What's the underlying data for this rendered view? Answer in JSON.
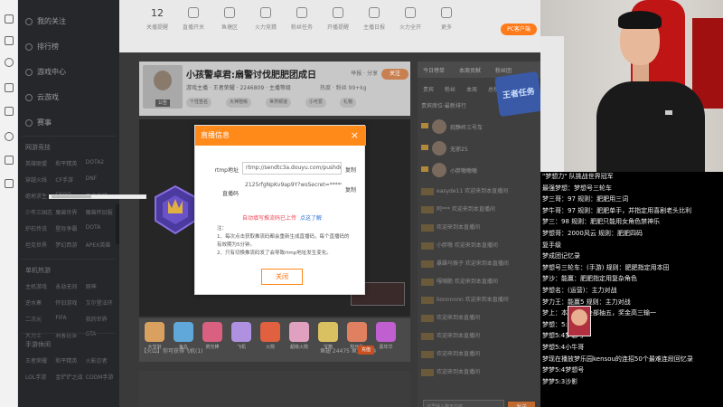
{
  "sidebar": {
    "items": [
      {
        "label": "我的关注"
      },
      {
        "label": "排行榜"
      },
      {
        "label": "游戏中心"
      },
      {
        "label": "云游戏"
      },
      {
        "label": "赛事"
      }
    ],
    "section_games": "网游竞技",
    "games": [
      "英雄联盟",
      "和平精英",
      "DOTA2",
      "穿越火线",
      "CF手游",
      "DNF",
      "绝地求生",
      "CSGO",
      "王者荣耀",
      "少年三国志",
      "魔兽世界",
      "魔兽怀旧服",
      "炉石传说",
      "星际争霸",
      "DOTA",
      "坦克世界",
      "梦幻西游",
      "APEX英雄"
    ],
    "section_mobile": "单机热游",
    "mobile": [
      "主机游戏",
      "永劫无间",
      "原神",
      "逆水寒",
      "怀旧游戏",
      "艾尔登法环",
      "二次元",
      "FIFA",
      "我的世界",
      "大力士",
      "刺客信条",
      "GTA"
    ],
    "section_hand": "手游休闲",
    "hand": [
      "王者荣耀",
      "和平精英",
      "火影忍者",
      "LOL手游",
      "金铲铲之战",
      "CODM手游"
    ]
  },
  "topbar": {
    "stat_value": "12",
    "stat_label": "关播提醒",
    "icons": [
      {
        "label": "直播开关"
      },
      {
        "label": "鱼塘区"
      },
      {
        "label": "火力竞猜"
      },
      {
        "label": "粉丝任务"
      },
      {
        "label": "开播提醒"
      },
      {
        "label": "主播日报"
      },
      {
        "label": "火力全开"
      },
      {
        "label": "更多"
      }
    ],
    "pc_button": "PC客户端"
  },
  "room": {
    "title": "小孩警卓君:扇警讨伐肥肥团成日",
    "subtitle": "游戏主播 · 王者荣耀 · 2246809 · 主播等级",
    "meta": "举报 · 分享",
    "stats": "热度 · 粉丝 99+kg",
    "follow": "关注",
    "avatar_tag": "公告",
    "chips": [
      "个性签名",
      "大神陪练",
      "世界频道",
      "小可爱",
      "礼物"
    ]
  },
  "rpanel": {
    "tabs": [
      "今日榜单",
      "本周贡献",
      "粉丝团"
    ],
    "subtabs": [
      "贵宾",
      "粉丝",
      "本周",
      "总榜"
    ],
    "sub": "贵宾席位·最新排行",
    "promo": "王者任务",
    "rank": [
      {
        "name": "寂静岭三号车"
      },
      {
        "name": "无邪25"
      },
      {
        "name": "小胖嗷嗷嗷"
      }
    ],
    "chat": [
      "easyde11 欢迎来到本直播间",
      "阿*** 欢迎来到本直播间",
      "欢迎来到本直播间",
      "小胖嗷 欢迎来到本直播间",
      "暴躁马猴子 欢迎来到本直播间",
      "嘎嘣脆 欢迎来到本直播间",
      "lionnnnnn 欢迎来到本直播间",
      "欢迎来到本直播间",
      "欢迎来到本直播间",
      "欢迎来到本直播间",
      "欢迎来到本直播间"
    ],
    "input_placeholder": "这里输入聊天内容",
    "send": "发送"
  },
  "gifts": {
    "labels": [
      "大宝剑",
      "鱼丸",
      "荧光棒",
      "飞机",
      "火箭",
      "超级火箭",
      "宝箱",
      "粉丝礼",
      "嘉年华"
    ],
    "status": "【火山】你可获得飞机(1)",
    "balance": "鱼翅 24475  鱼丸 26.4",
    "charge": "充值"
  },
  "modal": {
    "title": "直播信息",
    "close": "×",
    "rtmp_label": "rtmp地址",
    "rtmp_value": "rtmp://sendtc3a.douyu.com/pushdouyu",
    "code_label": "直播码",
    "code_value": "2125rfgNpKv9ap9Y?wsSecret=********",
    "copy": "复制",
    "warn": "自动填写推流码已上传",
    "link": "点这了解",
    "notes": [
      "注：",
      "1、每次点击获取推流码都会重新生成直播码，每个直播码的有效期为5分钟。",
      "2、只有切换推流码发了会导致rtmp地址发生变化。"
    ],
    "confirm": "关闭"
  },
  "overlay": {
    "lines": [
      "\"梦想力\" 队挑战世界冠军",
      "最强梦想：梦想号三轮车",
      "梦三哥：97  规则：肥肥用三词",
      "梦牛哥：97  规则：肥肥单手，并指定用喜剧老头比利",
      "梦三：98  规则：肥肥只能用女角色禁神乐",
      "梦想哥：2000风云  规则：肥肥四码",
      "复手级",
      "梦成团记忆录",
      "梦想号三轮车：(手游)  规则：肥肥指定用本田",
      "梦沙：能赢：肥肥指定用复杂角色",
      "梦想名：(运营)：主力对战",
      "梦力王：能赢5  规则：主力对战",
      "梦上：本场节目全部抽五，奖金高三输一",
      "梦想：5:4",
      "梦想5:4梦想号",
      "梦想5:4小牛哥",
      "梦现在播放梦乐园kensou的连招50个最难连段回忆录",
      "梦梦5:4梦想号",
      "梦梦5:3沙影"
    ]
  }
}
